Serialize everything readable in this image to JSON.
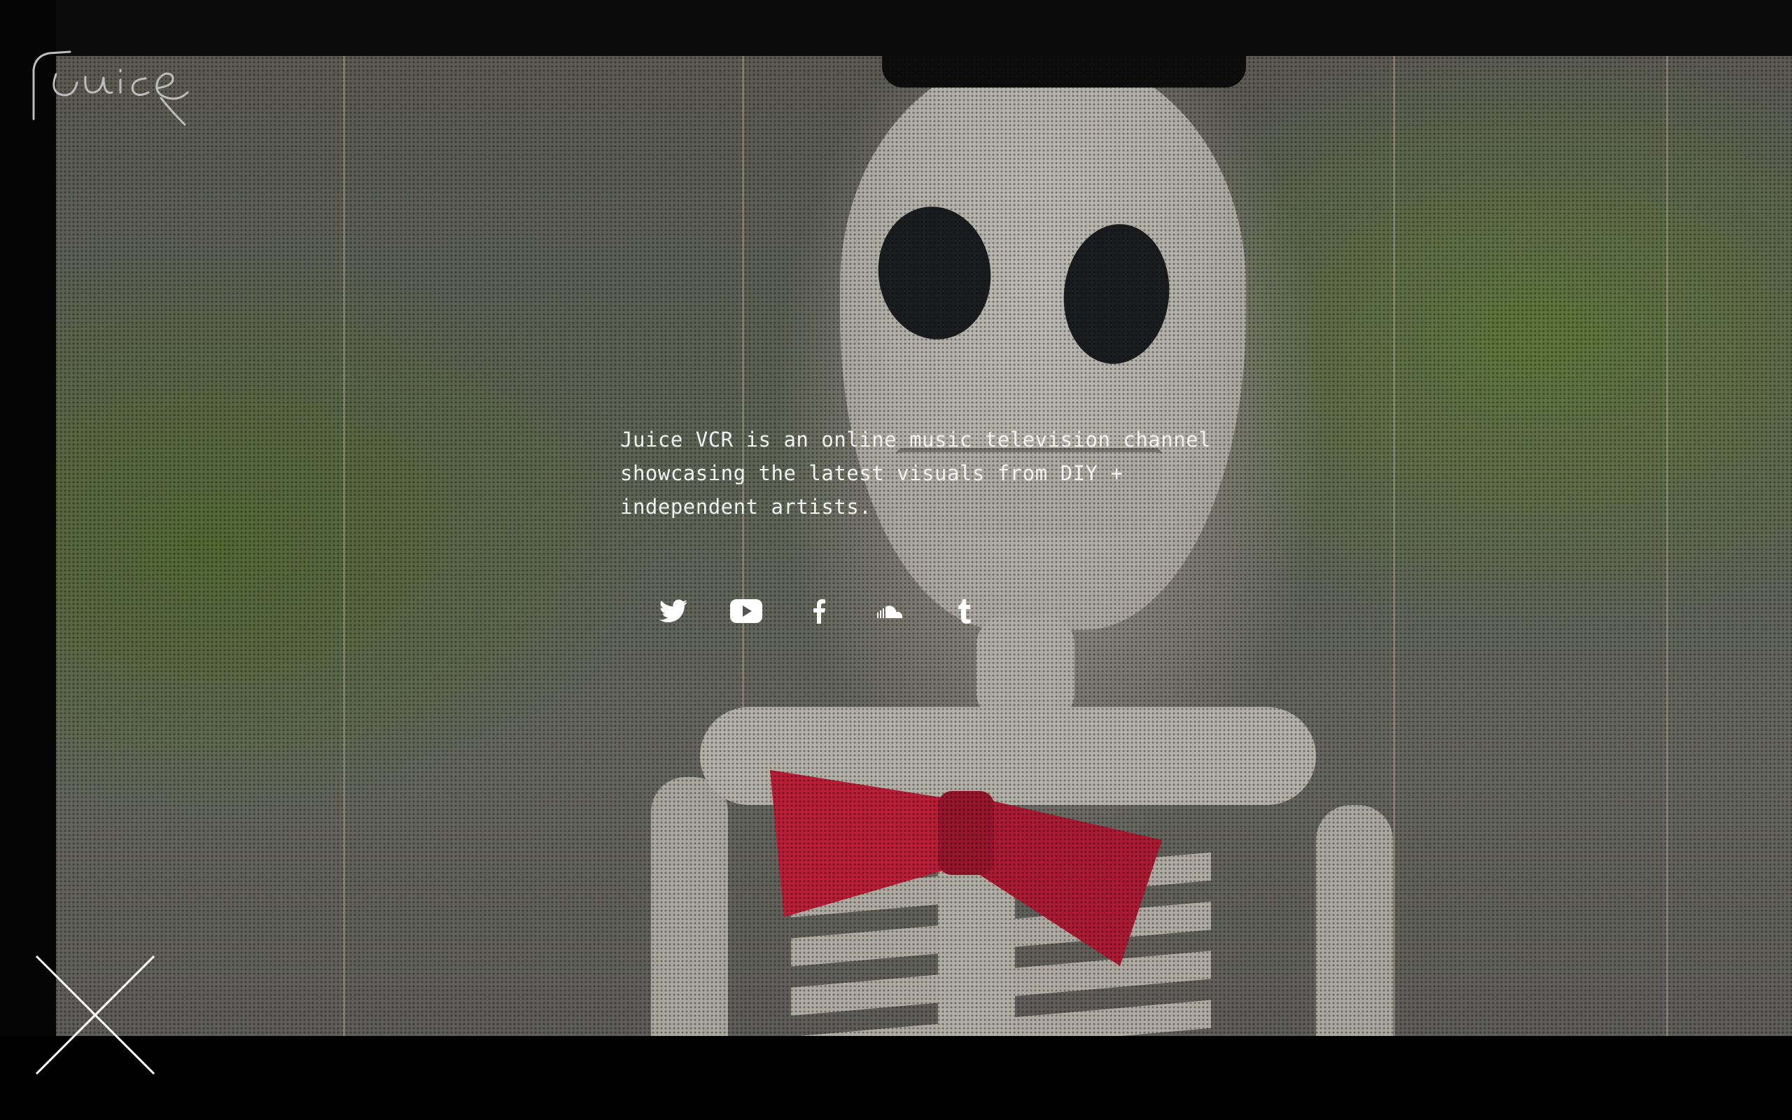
{
  "about": {
    "lines": [
      "Juice VCR is an online music television channel",
      "showcasing the latest visuals from DIY +",
      "independent artists."
    ]
  },
  "socials": [
    {
      "name": "twitter-icon"
    },
    {
      "name": "youtube-icon"
    },
    {
      "name": "facebook-icon"
    },
    {
      "name": "soundcloud-icon"
    },
    {
      "name": "tumblr-icon"
    }
  ],
  "colors": {
    "text": "#f2f2f2",
    "bowtie": "#d8233f",
    "bars": "#000000"
  }
}
